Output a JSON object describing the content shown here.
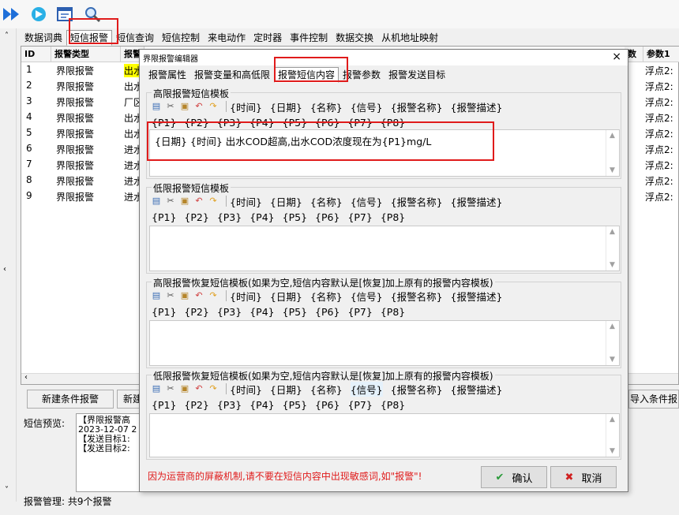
{
  "toolbar": {
    "icons": [
      "forward-icon",
      "refresh-icon",
      "window-icon",
      "search-icon"
    ]
  },
  "main_tabs": [
    "数据词典",
    "短信报警",
    "短信查询",
    "短信控制",
    "来电动作",
    "定时器",
    "事件控制",
    "数据交换",
    "从机地址映射"
  ],
  "table": {
    "headers": [
      "ID",
      "报警类型",
      "报警",
      "数",
      "参数1"
    ],
    "rows": [
      {
        "id": "1",
        "type": "界限报警",
        "name": "出水",
        "p1": "浮点2:"
      },
      {
        "id": "2",
        "type": "界限报警",
        "name": "出水",
        "p1": "浮点2:"
      },
      {
        "id": "3",
        "type": "界限报警",
        "name": "厂区",
        "p1": "浮点2:"
      },
      {
        "id": "4",
        "type": "界限报警",
        "name": "出水",
        "p1": "浮点2:"
      },
      {
        "id": "5",
        "type": "界限报警",
        "name": "出水",
        "p1": "浮点2:"
      },
      {
        "id": "6",
        "type": "界限报警",
        "name": "进水",
        "p1": "浮点2:"
      },
      {
        "id": "7",
        "type": "界限报警",
        "name": "进水",
        "p1": "浮点2:"
      },
      {
        "id": "8",
        "type": "界限报警",
        "name": "进水",
        "p1": "浮点2:"
      },
      {
        "id": "9",
        "type": "界限报警",
        "name": "进水",
        "p1": "浮点2:"
      }
    ]
  },
  "buttons": {
    "new_condition": "新建条件报警",
    "new_partial": "新建",
    "import_condition": "导入条件报"
  },
  "preview": {
    "label": "短信预览:",
    "line1": "【界限报警高",
    "line2": "2023-12-07 2",
    "line3": "【发送目标1:",
    "line4": "【发送目标2:"
  },
  "status": "报警管理: 共9个报警",
  "dialog": {
    "title": "界限报警编辑器",
    "close": "×",
    "tabs": [
      "报警属性",
      "报警变量和高低限",
      "报警短信内容",
      "报警参数",
      "报警发送目标"
    ],
    "tokens": [
      "{时间}",
      "{日期}",
      "{名称}",
      "{信号}",
      "{报警名称}",
      "{报警描述}"
    ],
    "params": [
      "{P1}",
      "{P2}",
      "{P3}",
      "{P4}",
      "{P5}",
      "{P6}",
      "{P7}",
      "{P8}"
    ],
    "groups": [
      {
        "title": "高限报警短信模板",
        "content": "{日期} {时间} 出水COD超高,出水COD浓度现在为{P1}mg/L"
      },
      {
        "title": "低限报警短信模板",
        "content": ""
      },
      {
        "title": "高限报警恢复短信模板(如果为空,短信内容默认是[恢复]加上原有的报警内容模板)",
        "content": ""
      },
      {
        "title": "低限报警恢复短信模板(如果为空,短信内容默认是[恢复]加上原有的报警内容模板)",
        "content": ""
      }
    ],
    "warning": "因为运营商的屏蔽机制,请不要在短信内容中出现敏感词,如\"报警\"!",
    "ok": "确认",
    "cancel": "取消"
  }
}
